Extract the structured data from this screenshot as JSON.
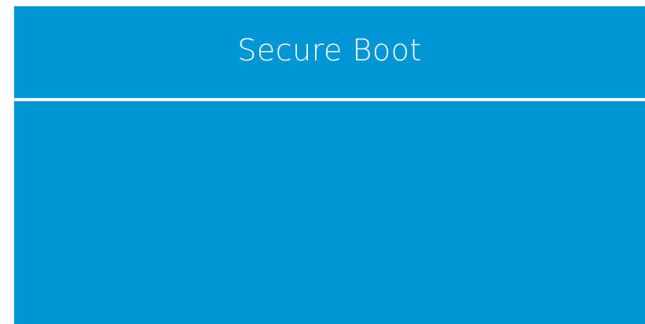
{
  "window": {
    "title": "Secure Boot"
  },
  "colors": {
    "background": "#0096d6",
    "text": "#ffffff",
    "divider": "#ffffff"
  }
}
